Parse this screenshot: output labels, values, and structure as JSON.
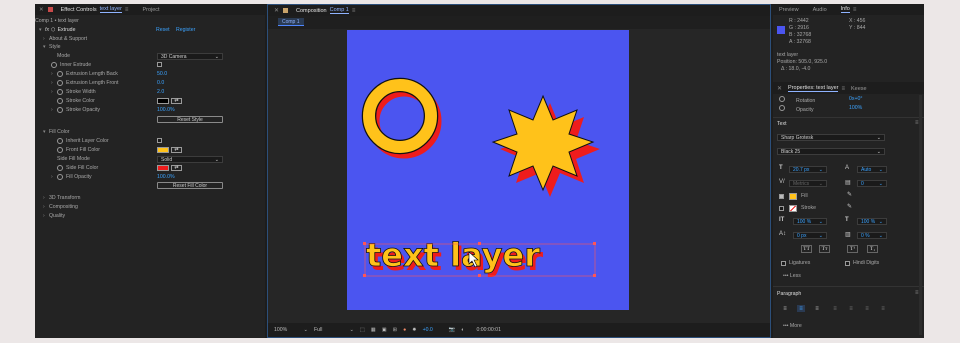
{
  "effect_controls": {
    "tab_label": "Effect Controls",
    "tab_layer": "text layer",
    "project_tab": "Project",
    "breadcrumb": "Comp 1 • text layer",
    "effect_name": "Extrude",
    "reset": "Reset",
    "register": "Register",
    "about_support": "About & Support",
    "style_group": "Style",
    "mode_label": "Mode",
    "mode_value": "3D Camera",
    "inner_extrude": "Inner Extrude",
    "ext_back_label": "Extrusion Length Back",
    "ext_back_value": "50.0",
    "ext_front_label": "Extrusion Length Front",
    "ext_front_value": "0.0",
    "stroke_width_label": "Stroke Width",
    "stroke_width_value": "2.0",
    "stroke_color_label": "Stroke Color",
    "stroke_opacity_label": "Stroke Opacity",
    "stroke_opacity_value": "100.0%",
    "reset_style": "Reset Style",
    "fill_group": "Fill Color",
    "inherit_layer_color": "Inherit Layer Color",
    "front_fill_label": "Front Fill Color",
    "side_fill_mode_label": "Side Fill Mode",
    "side_fill_mode_value": "Solid",
    "side_fill_color_label": "Side Fill Color",
    "fill_opacity_label": "Fill Opacity",
    "fill_opacity_value": "100.0%",
    "reset_fill": "Reset Fill Color",
    "transform_3d": "3D Transform",
    "compositing": "Compositing",
    "quality": "Quality"
  },
  "composition": {
    "tab_label": "Composition",
    "tab_comp": "Comp 1",
    "comp_chip": "Comp 1",
    "zoom": "100%",
    "resolution": "Full",
    "exposure": "+0.0",
    "timecode": "0:00:00:01",
    "canvas_text": "text layer"
  },
  "info": {
    "tab_preview": "Preview",
    "tab_audio": "Audio",
    "tab_info": "Info",
    "r": "2442",
    "g": "2916",
    "b": "32768",
    "a": "32768",
    "x": "X : 456",
    "y": "Y : 844",
    "layer": "text layer",
    "position": "Position: 505.0, 925.0",
    "delta": "Δ : 18.0, -4.0"
  },
  "properties": {
    "tab_label": "Properties: text layer",
    "tab_keese": "Keese",
    "rotation_label": "Rotation",
    "rotation_value": "0x+0°",
    "opacity_label": "Opacity",
    "opacity_value": "100%",
    "text_section": "Text",
    "font_family": "Sharp Grotesk",
    "font_style": "Black 25",
    "font_size": "20.7 px",
    "leading": "Auto",
    "kerning": "Metrics",
    "tracking": "0",
    "fill_label": "Fill",
    "stroke_label": "Stroke",
    "v_scale": "100 %",
    "h_scale": "100 %",
    "baseline": "0 px",
    "tsume": "0 %",
    "ligatures": "Ligatures",
    "hindi_digits": "Hindi Digits",
    "less": "Less",
    "paragraph_section": "Paragraph",
    "more": "More"
  },
  "colors": {
    "canvas": "#4b55f0",
    "yellow": "#ffc21a",
    "red": "#ee1c1c",
    "accent": "#3ba3ff"
  }
}
